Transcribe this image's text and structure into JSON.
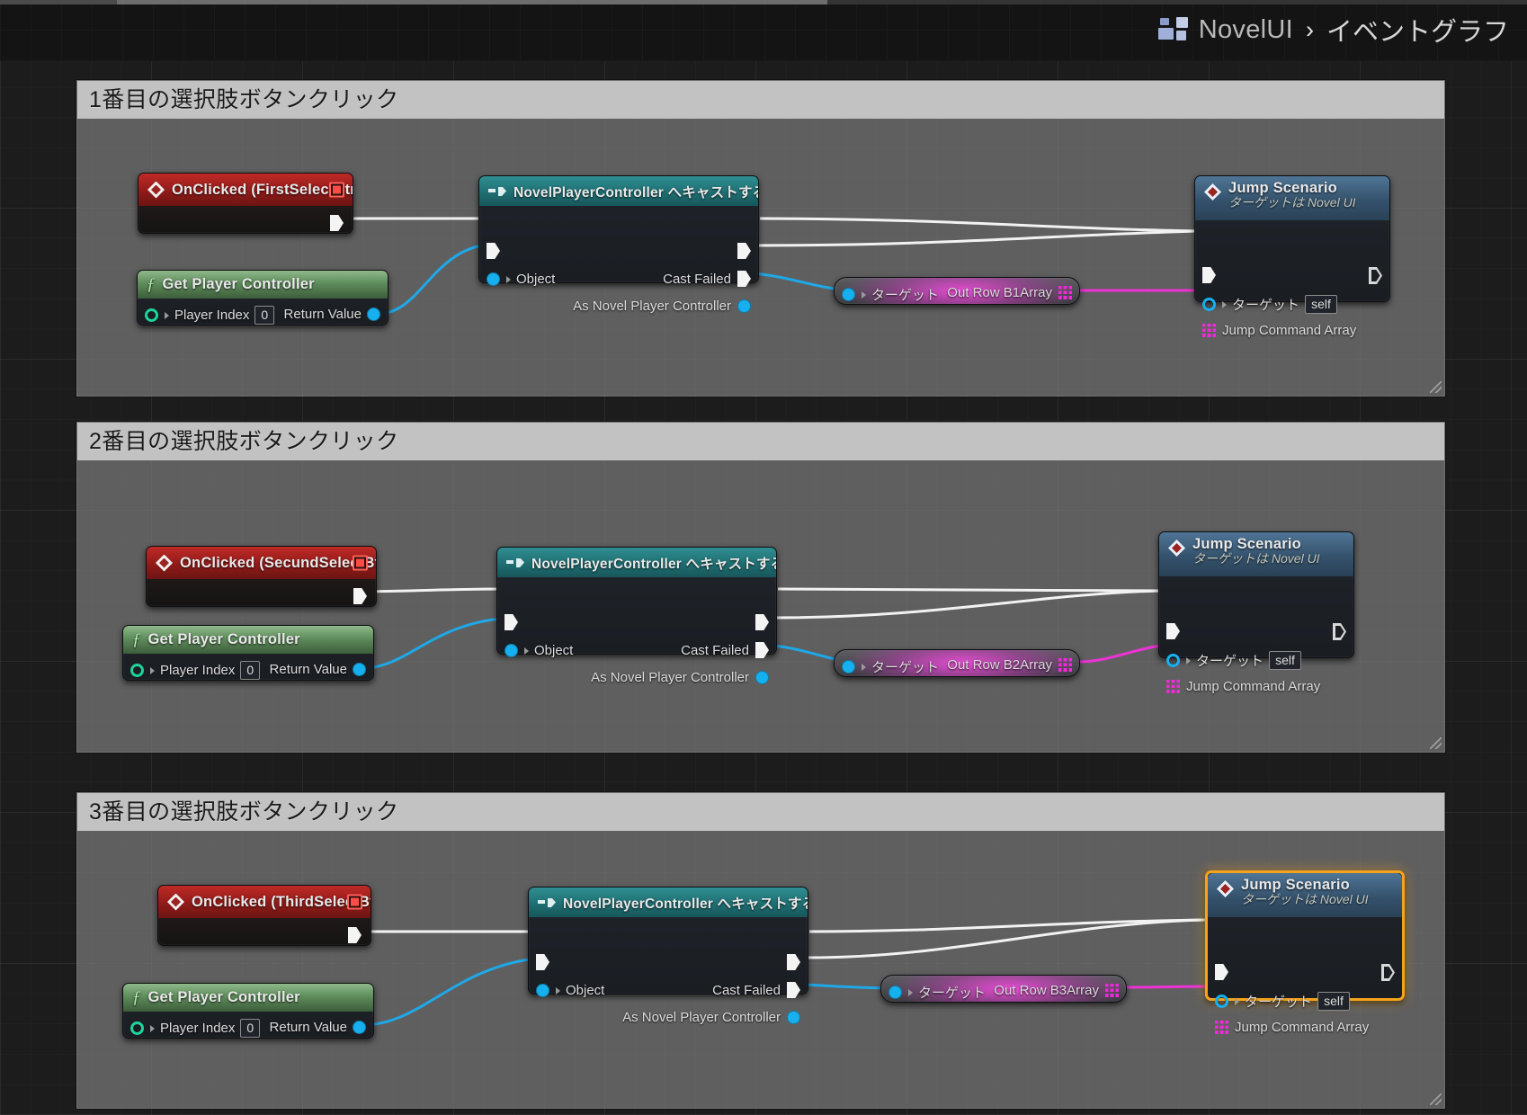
{
  "header": {
    "app_icon": "blueprint-icon",
    "breadcrumb_root": "NovelUI",
    "breadcrumb_separator": "›",
    "breadcrumb_leaf": "イベントグラフ"
  },
  "colors": {
    "event_red": "#8b1a18",
    "function_green": "#5f8d5c",
    "cast_teal": "#1f6e72",
    "call_blue": "#35526c",
    "variable_magenta": "#ec4cd8",
    "exec_white": "#f4f4f4",
    "object_blue": "#17b0ef",
    "selection_orange": "#f5a31a",
    "comment_header": "#c2c2c2",
    "comment_body": "#7a7a7a"
  },
  "sections": [
    {
      "comment_title": "1番目の選択肢ボタンクリック",
      "event_node": {
        "title": "OnClicked (FirstSelectBtn)",
        "icon": "event-diamond-icon",
        "stop_icon": "stop-record-icon"
      },
      "get_player_controller": {
        "title": "Get Player Controller",
        "icon": "function-f-icon",
        "input_label": "Player Index",
        "input_value": "0",
        "output_label": "Return Value"
      },
      "cast_node": {
        "title": "NovelPlayerController へキャストする",
        "icon": "cast-arrow-icon",
        "input_object": "Object",
        "output_cast_failed": "Cast Failed",
        "output_as": "As Novel Player Controller"
      },
      "variable_node": {
        "target_label": "ターゲット",
        "output_label": "Out Row B1Array",
        "icon": "array-pin-icon"
      },
      "jump_node": {
        "title": "Jump Scenario",
        "subtitle": "ターゲットは Novel UI",
        "icon": "function-diamond-icon",
        "target_label": "ターゲット",
        "target_value": "self",
        "array_label": "Jump Command Array",
        "selected": false
      }
    },
    {
      "comment_title": "2番目の選択肢ボタンクリック",
      "event_node": {
        "title": "OnClicked (SecundSelectBtn)",
        "icon": "event-diamond-icon",
        "stop_icon": "stop-record-icon"
      },
      "get_player_controller": {
        "title": "Get Player Controller",
        "icon": "function-f-icon",
        "input_label": "Player Index",
        "input_value": "0",
        "output_label": "Return Value"
      },
      "cast_node": {
        "title": "NovelPlayerController へキャストする",
        "icon": "cast-arrow-icon",
        "input_object": "Object",
        "output_cast_failed": "Cast Failed",
        "output_as": "As Novel Player Controller"
      },
      "variable_node": {
        "target_label": "ターゲット",
        "output_label": "Out Row B2Array",
        "icon": "array-pin-icon"
      },
      "jump_node": {
        "title": "Jump Scenario",
        "subtitle": "ターゲットは Novel UI",
        "icon": "function-diamond-icon",
        "target_label": "ターゲット",
        "target_value": "self",
        "array_label": "Jump Command Array",
        "selected": false
      }
    },
    {
      "comment_title": "3番目の選択肢ボタンクリック",
      "event_node": {
        "title": "OnClicked (ThirdSelectBtn)",
        "icon": "event-diamond-icon",
        "stop_icon": "stop-record-icon"
      },
      "get_player_controller": {
        "title": "Get Player Controller",
        "icon": "function-f-icon",
        "input_label": "Player Index",
        "input_value": "0",
        "output_label": "Return Value"
      },
      "cast_node": {
        "title": "NovelPlayerController へキャストする",
        "icon": "cast-arrow-icon",
        "input_object": "Object",
        "output_cast_failed": "Cast Failed",
        "output_as": "As Novel Player Controller"
      },
      "variable_node": {
        "target_label": "ターゲット",
        "output_label": "Out Row B3Array",
        "icon": "array-pin-icon"
      },
      "jump_node": {
        "title": "Jump Scenario",
        "subtitle": "ターゲットは Novel UI",
        "icon": "function-diamond-icon",
        "target_label": "ターゲット",
        "target_value": "self",
        "array_label": "Jump Command Array",
        "selected": true
      }
    }
  ]
}
